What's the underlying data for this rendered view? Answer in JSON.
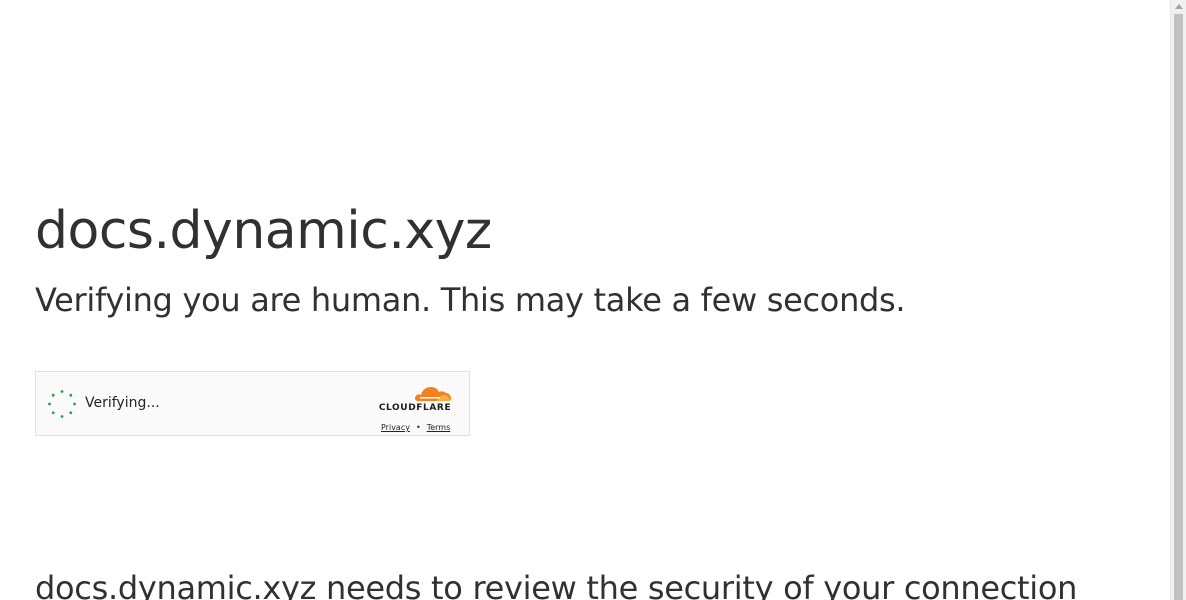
{
  "page": {
    "site_title": "docs.dynamic.xyz",
    "subtitle": "Verifying you are human. This may take a few seconds.",
    "body_text": "docs.dynamic.xyz needs to review the security of your connection"
  },
  "widget": {
    "status_label": "Verifying...",
    "spinner_icon": "loading-spinner-icon",
    "spinner_color": "#2c9f4a",
    "brand": {
      "wordmark": "CLOUDFLARE",
      "cloud_icon": "cloudflare-cloud-icon",
      "cloud_color": "#f48120",
      "privacy_link": "Privacy",
      "separator": "•",
      "terms_link": "Terms"
    }
  },
  "colors": {
    "text": "#313131",
    "background": "#ffffff",
    "widget_border": "#e0e0e0"
  }
}
